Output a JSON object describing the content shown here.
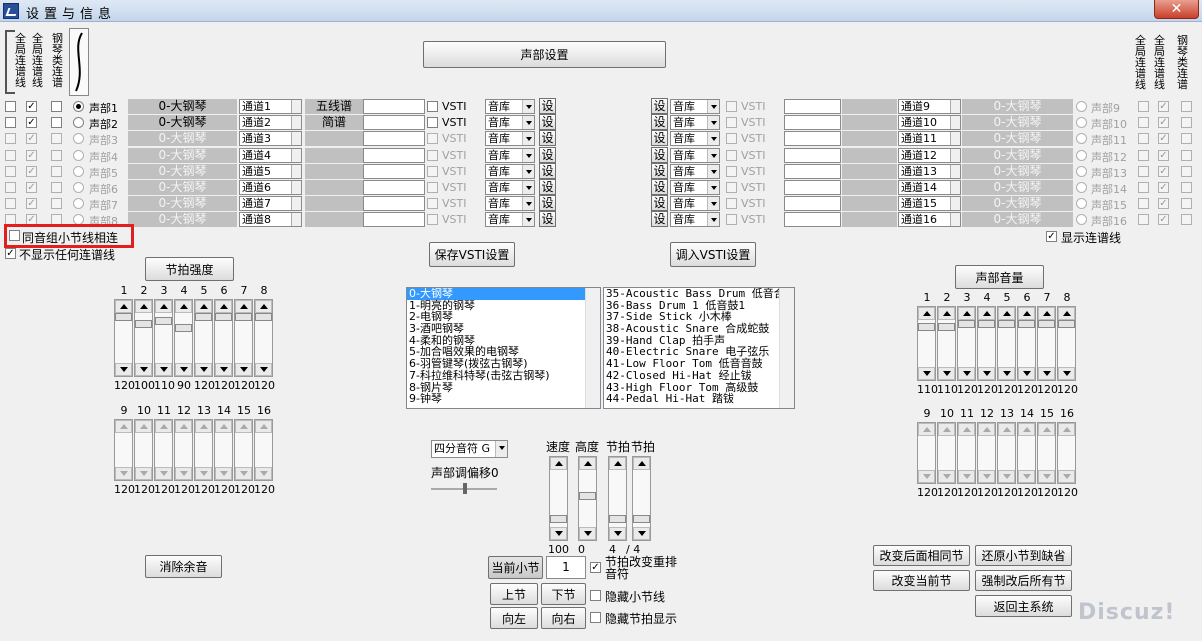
{
  "window": {
    "title": "设置与信息",
    "close": "✕"
  },
  "header": {
    "voice_settings": "声部设置",
    "left_vlabels": [
      "全局连谱线",
      "全局连谱线",
      "钢琴类连谱"
    ],
    "right_vlabels": [
      "全局连谱线",
      "全局连谱线",
      "钢琴类连谱"
    ]
  },
  "left_rows": [
    {
      "voice": "声部1",
      "inst": "0-大钢琴",
      "chan": "通道1",
      "staff": "五线谱",
      "vsti": "VSTI",
      "lib": "音库",
      "set": "设",
      "active": true,
      "radio": true,
      "cb2": true
    },
    {
      "voice": "声部2",
      "inst": "0-大钢琴",
      "chan": "通道2",
      "staff": "简谱",
      "vsti": "VSTI",
      "lib": "音库",
      "set": "设",
      "active": true,
      "radio": false,
      "cb2": true
    },
    {
      "voice": "声部3",
      "inst": "0-大钢琴",
      "chan": "通道3",
      "staff": "",
      "vsti": "VSTI",
      "lib": "音库",
      "set": "设",
      "active": false,
      "radio": false,
      "cb2": true
    },
    {
      "voice": "声部4",
      "inst": "0-大钢琴",
      "chan": "通道4",
      "staff": "",
      "vsti": "VSTI",
      "lib": "音库",
      "set": "设",
      "active": false,
      "radio": false,
      "cb2": true
    },
    {
      "voice": "声部5",
      "inst": "0-大钢琴",
      "chan": "通道5",
      "staff": "",
      "vsti": "VSTI",
      "lib": "音库",
      "set": "设",
      "active": false,
      "radio": false,
      "cb2": true
    },
    {
      "voice": "声部6",
      "inst": "0-大钢琴",
      "chan": "通道6",
      "staff": "",
      "vsti": "VSTI",
      "lib": "音库",
      "set": "设",
      "active": false,
      "radio": false,
      "cb2": true
    },
    {
      "voice": "声部7",
      "inst": "0-大钢琴",
      "chan": "通道7",
      "staff": "",
      "vsti": "VSTI",
      "lib": "音库",
      "set": "设",
      "active": false,
      "radio": false,
      "cb2": true
    },
    {
      "voice": "声部8",
      "inst": "0-大钢琴",
      "chan": "通道8",
      "staff": "",
      "vsti": "VSTI",
      "lib": "音库",
      "set": "设",
      "active": false,
      "radio": false,
      "cb2": true
    }
  ],
  "right_rows": [
    {
      "voice": "声部9",
      "inst": "0-大钢琴",
      "chan": "通道9",
      "vsti": "VSTI",
      "lib": "音库",
      "set": "设"
    },
    {
      "voice": "声部10",
      "inst": "0-大钢琴",
      "chan": "通道10",
      "vsti": "VSTI",
      "lib": "音库",
      "set": "设"
    },
    {
      "voice": "声部11",
      "inst": "0-大钢琴",
      "chan": "通道11",
      "vsti": "VSTI",
      "lib": "音库",
      "set": "设"
    },
    {
      "voice": "声部12",
      "inst": "0-大钢琴",
      "chan": "通道12",
      "vsti": "VSTI",
      "lib": "音库",
      "set": "设"
    },
    {
      "voice": "声部13",
      "inst": "0-大钢琴",
      "chan": "通道13",
      "vsti": "VSTI",
      "lib": "音库",
      "set": "设"
    },
    {
      "voice": "声部14",
      "inst": "0-大钢琴",
      "chan": "通道14",
      "vsti": "VSTI",
      "lib": "音库",
      "set": "设"
    },
    {
      "voice": "声部15",
      "inst": "0-大钢琴",
      "chan": "通道15",
      "vsti": "VSTI",
      "lib": "音库",
      "set": "设"
    },
    {
      "voice": "声部16",
      "inst": "0-大钢琴",
      "chan": "通道16",
      "vsti": "VSTI",
      "lib": "音库",
      "set": "设"
    }
  ],
  "options": {
    "same_group_bar": "同音组小节线相连",
    "hide_tie": "不显示任何连谱线",
    "show_tie": "显示连谱线"
  },
  "buttons": {
    "save_vsti": "保存VSTI设置",
    "load_vsti": "调入VSTI设置",
    "beat_strength": "节拍强度",
    "voice_volume": "声部音量",
    "clear_reverb": "消除余音",
    "current_bar": "当前小节",
    "bar_value": "1",
    "prev_bar": "上节",
    "next_bar": "下节",
    "left": "向左",
    "right": "向右",
    "change_following": "改变后面相同节",
    "restore_bar": "还原小节到缺省",
    "change_current": "改变当前节",
    "force_all": "强制改后所有节",
    "return_main": "返回主系统"
  },
  "checks": {
    "beat_rearrange": "节拍改变重排音符",
    "hide_barline": "隐藏小节线",
    "hide_beat": "隐藏节拍显示"
  },
  "beat": {
    "nums1": [
      "1",
      "2",
      "3",
      "4",
      "5",
      "6",
      "7",
      "8"
    ],
    "vals1": [
      "120",
      "100",
      "110",
      "90",
      "120",
      "120",
      "120",
      "120"
    ],
    "levels1": [
      1,
      0.83,
      0.92,
      0.75,
      1,
      1,
      1,
      1
    ],
    "nums2": [
      "9",
      "10",
      "11",
      "12",
      "13",
      "14",
      "15",
      "16"
    ],
    "vals2": [
      "120",
      "120",
      "120",
      "120",
      "120",
      "120",
      "120",
      "120"
    ]
  },
  "volume": {
    "nums1": [
      "1",
      "2",
      "3",
      "4",
      "5",
      "6",
      "7",
      "8"
    ],
    "vals1": [
      "110",
      "110",
      "120",
      "120",
      "120",
      "120",
      "120",
      "120"
    ],
    "levels1": [
      0.92,
      0.92,
      1,
      1,
      1,
      1,
      1,
      1
    ],
    "nums2": [
      "9",
      "10",
      "11",
      "12",
      "13",
      "14",
      "15",
      "16"
    ],
    "vals2": [
      "120",
      "120",
      "120",
      "120",
      "120",
      "120",
      "120",
      "120"
    ]
  },
  "instrument_list": [
    "0-大钢琴",
    "1-明亮的钢琴",
    "2-电钢琴",
    "3-酒吧钢琴",
    "4-柔和的钢琴",
    "5-加合唱效果的电钢琴",
    "6-羽管键琴(拨弦古钢琴)",
    "7-科拉维科特琴(击弦古钢琴)",
    "8-钢片琴",
    "9-钟琴"
  ],
  "drum_list": [
    "35-Acoustic Bass Drum  低音合",
    "36-Bass Drum 1 低音鼓1",
    "37-Side Stick 小木棒",
    "38-Acoustic Snare 合成蛇鼓",
    "39-Hand Clap 拍手声",
    "40-Electric Snare 电子弦乐",
    "41-Low Floor Tom 低音音鼓",
    "42-Closed Hi-Hat 经止钹",
    "43-High Floor Tom 高级鼓",
    "44-Pedal Hi-Hat 踏钹"
  ],
  "tempo": {
    "note_select": "四分音符 G",
    "offset_label": "声部调偏移0",
    "speed": "速度",
    "height": "高度",
    "beat1": "节拍",
    "beat2": "节拍",
    "speed_val": "100",
    "height_val": "0",
    "beat_num": "4",
    "beat_den": "/ 4"
  },
  "watermark": "Discuz!"
}
